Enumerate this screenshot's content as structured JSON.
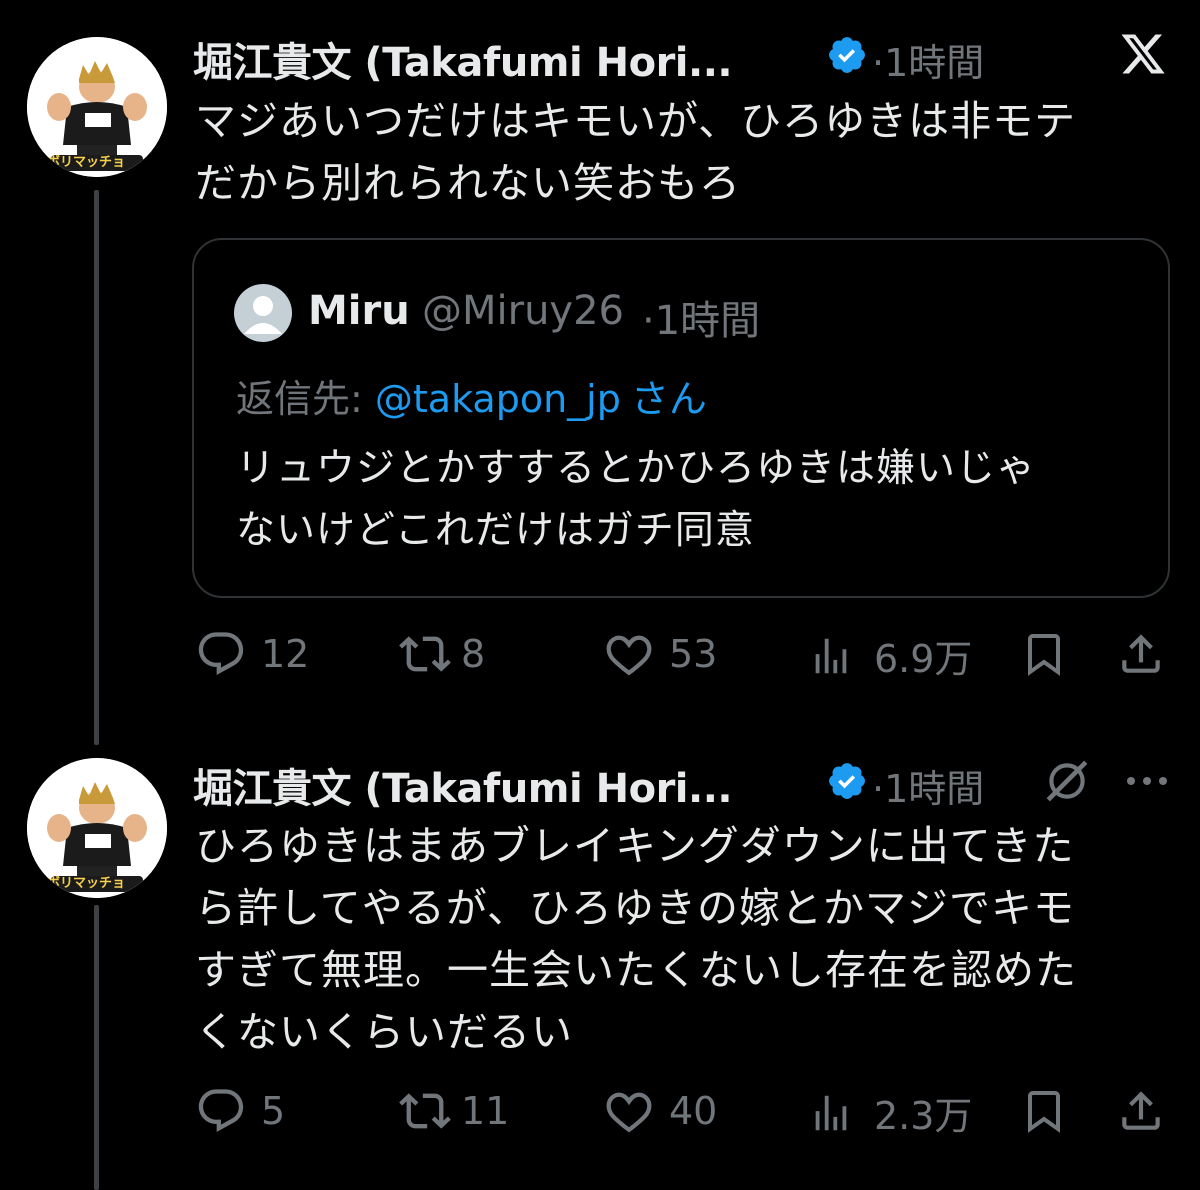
{
  "tweets": [
    {
      "author": "堀江貴文 (Takafumi Hori...",
      "time": "·1時間",
      "text_lines": [
        "マジあいつだけはキモいが、ひろゆきは非モテ",
        "だから別れられない笑おもろ"
      ],
      "avatar_label": "ボリマッチョ",
      "quote": {
        "name": "Miru",
        "handle": "@Miruy26",
        "time": "·1時間",
        "reply_prefix": "返信先:",
        "reply_mention": "@takapon_jp",
        "reply_suffix": "さん",
        "text_lines": [
          "リュウジとかすするとかひろゆきは嫌いじゃ",
          "ないけどこれだけはガチ同意"
        ]
      },
      "actions": {
        "replies": "12",
        "retweets": "8",
        "likes": "53",
        "views": "6.9万"
      }
    },
    {
      "author": "堀江貴文 (Takafumi Hori...",
      "time": "·1時間",
      "text_lines": [
        "ひろゆきはまあブレイキングダウンに出てきた",
        "ら許してやるが、ひろゆきの嫁とかマジでキモ",
        "すぎて無理。一生会いたくないし存在を認めた",
        "くないくらいだるい"
      ],
      "avatar_label": "ボリマッチョ",
      "actions": {
        "replies": "5",
        "retweets": "11",
        "likes": "40",
        "views": "2.3万"
      }
    }
  ],
  "colors": {
    "background": "#000000",
    "text": "#e7e9ea",
    "muted": "#71767b",
    "link": "#1d9bf0",
    "verified": "#1d9bf0",
    "border": "#2f3336"
  },
  "icons": [
    "x-logo-icon",
    "verified-badge-icon",
    "grok-icon",
    "more-icon",
    "reply-icon",
    "retweet-icon",
    "like-icon",
    "views-icon",
    "bookmark-icon",
    "share-icon",
    "default-avatar-icon"
  ]
}
